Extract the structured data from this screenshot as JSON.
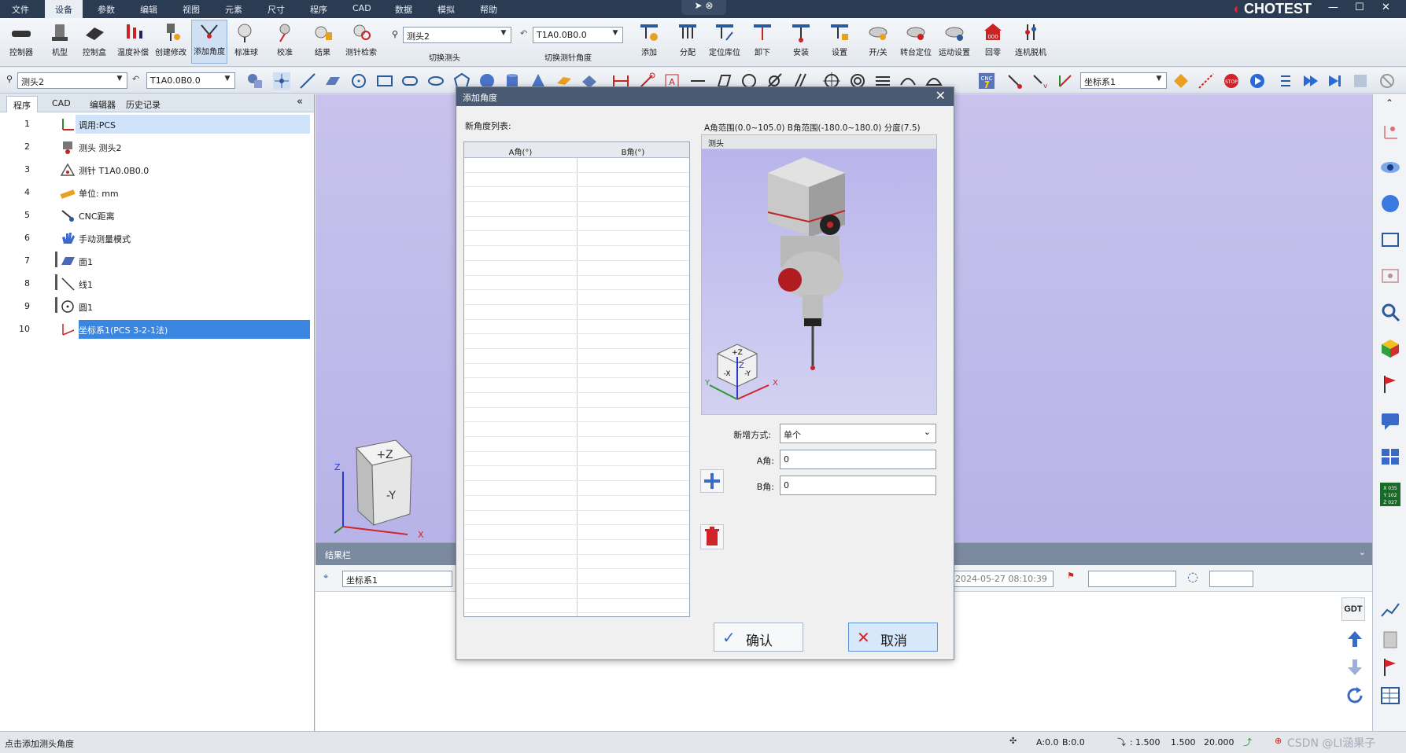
{
  "menu": [
    "文件",
    "设备",
    "参数",
    "编辑",
    "视图",
    "元素",
    "尺寸",
    "程序",
    "CAD",
    "数据",
    "模拟",
    "帮助"
  ],
  "menu_active": "设备",
  "brand": "CHOTEST",
  "ribbon": {
    "buttons": [
      "控制器",
      "机型",
      "控制盒",
      "温度补偿",
      "创建修改",
      "添加角度",
      "标准球",
      "校准",
      "结果",
      "测针检索"
    ],
    "buttons2": [
      "添加",
      "分配",
      "定位库位",
      "卸下",
      "安装",
      "设置",
      "开/关",
      "转台定位",
      "运动设置",
      "回零",
      "连机脱机"
    ],
    "probe_combo": "测头2",
    "probe_group_label": "切换测头",
    "tip_combo": "T1A0.0B0.0",
    "tip_group_label": "切换测针角度"
  },
  "toolbar2": {
    "probe_combo": "测头2",
    "tip_combo": "T1A0.0B0.0",
    "coord_combo": "坐标系1"
  },
  "left_panel": {
    "tabs": [
      "程序",
      "CAD",
      "编辑器",
      "历史记录"
    ],
    "rows": [
      {
        "num": "1",
        "label": "调用:PCS"
      },
      {
        "num": "2",
        "label": "测头 测头2"
      },
      {
        "num": "3",
        "label": "测针 T1A0.0B0.0"
      },
      {
        "num": "4",
        "label": "单位: mm"
      },
      {
        "num": "5",
        "label": "CNC距离"
      },
      {
        "num": "6",
        "label": "手动测量模式"
      },
      {
        "num": "7",
        "label": "面1"
      },
      {
        "num": "8",
        "label": "线1"
      },
      {
        "num": "9",
        "label": "圆1"
      },
      {
        "num": "10",
        "label": "坐标系1(PCS 3-2-1法)"
      }
    ]
  },
  "viewport": {
    "cube_top": "+Z",
    "cube_front": "-Y",
    "axis_z": "Z",
    "axis_x": "X"
  },
  "results": {
    "title": "结果栏",
    "coord_field": "坐标系1",
    "timestamp": "2024-05-27 08:10:39"
  },
  "rightbar": {
    "gdt": "GDT",
    "coords": [
      "X 035",
      "Y 102",
      "Z 027"
    ]
  },
  "statusbar": {
    "hint": "点击添加测头角度",
    "a": "A:0.0",
    "b": "B:0.0",
    "v1": "1.500",
    "v2": "1.500",
    "v3": "20.000",
    "watermark": "CSDN @LI涵果子"
  },
  "dialog": {
    "title": "添加角度",
    "list_label": "新角度列表:",
    "range_text": "A角范围(0.0~105.0) B角范围(-180.0~180.0) 分度(7.5)",
    "col_a": "A角(°)",
    "col_b": "B角(°)",
    "preview_label": "测头",
    "mode_label": "新增方式:",
    "mode_value": "单个",
    "a_label": "A角:",
    "a_value": "0",
    "b_label": "B角:",
    "b_value": "0",
    "ok": "确认",
    "cancel": "取消",
    "cube_labels": [
      "+Z",
      "-X",
      "-Y"
    ],
    "axes": [
      "Z",
      "Y",
      "X"
    ]
  },
  "colors": {
    "menubar": "#2a3b52",
    "selection": "#3b86e0",
    "brand_red": "#e0262a",
    "viewport": "#c8c2ec"
  }
}
